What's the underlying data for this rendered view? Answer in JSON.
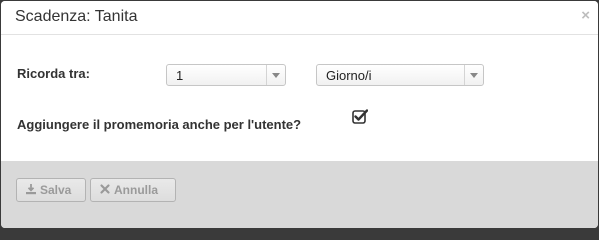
{
  "dialog": {
    "title": "Scadenza: Tanita",
    "close_label": "×"
  },
  "form": {
    "remind_label": "Ricorda tra:",
    "amount_value": "1",
    "unit_value": "Giorno/i",
    "user_reminder_label": "Aggiungere il promemoria anche per l'utente?",
    "user_reminder_checked": true
  },
  "footer": {
    "save_label": "Salva",
    "cancel_label": "Annulla"
  },
  "icons": {
    "save": "download-icon",
    "cancel": "x-icon",
    "checkbox": "checkbox-checked-icon"
  }
}
